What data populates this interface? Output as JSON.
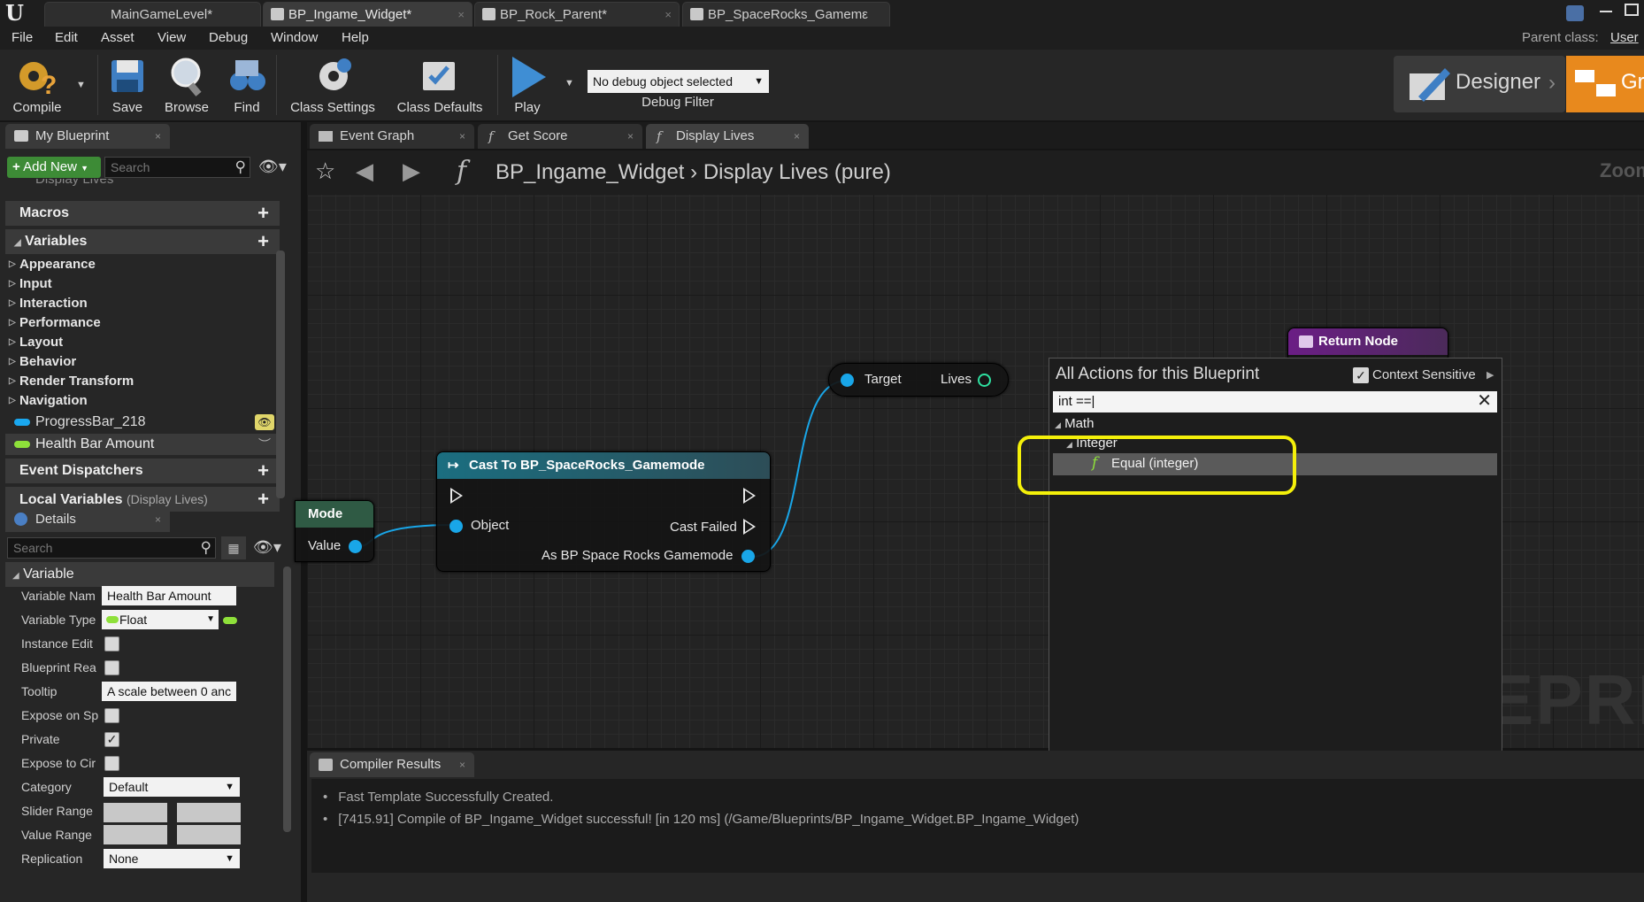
{
  "app": {
    "logo": "U",
    "tabs": [
      {
        "label": "MainGameLevel*"
      },
      {
        "label": "BP_Ingame_Widget*"
      },
      {
        "label": "BP_Rock_Parent*"
      },
      {
        "label": "BP_SpaceRocks_Gamemε"
      }
    ],
    "parent_class_label": "Parent class:",
    "parent_class_value": "User"
  },
  "menu": [
    "File",
    "Edit",
    "Asset",
    "View",
    "Debug",
    "Window",
    "Help"
  ],
  "toolbar": {
    "compile": "Compile",
    "save": "Save",
    "browse": "Browse",
    "find": "Find",
    "class_settings": "Class Settings",
    "class_defaults": "Class Defaults",
    "play": "Play",
    "debug_object": "No debug object selected",
    "debug_filter": "Debug Filter",
    "designer": "Designer",
    "graph": "Gr"
  },
  "my_blueprint": {
    "tab": "My Blueprint",
    "add_new": "Add New",
    "search_placeholder": "Search",
    "partial_item": "Display Lives",
    "macros": "Macros",
    "variables": "Variables",
    "categories": [
      "Appearance",
      "Input",
      "Interaction",
      "Performance",
      "Layout",
      "Behavior",
      "Render Transform",
      "Navigation"
    ],
    "vars": [
      {
        "name": "ProgressBar_218",
        "type_color": "#1aa8f0"
      },
      {
        "name": "Health Bar Amount",
        "type_color": "#8ee03a"
      }
    ],
    "event_dispatchers": "Event Dispatchers",
    "local_variables": "Local Variables",
    "local_variables_scope": "(Display Lives)"
  },
  "details": {
    "tab": "Details",
    "search_placeholder": "Search",
    "section": "Variable",
    "rows": {
      "variable_name_label": "Variable Nam",
      "variable_name_value": "Health Bar Amount",
      "variable_type_label": "Variable Type",
      "variable_type_value": "Float",
      "instance_edit_label": "Instance Edit",
      "blueprint_read_label": "Blueprint Rea",
      "tooltip_label": "Tooltip",
      "tooltip_value": "A scale between 0 anc",
      "expose_spawn_label": "Expose on Sp",
      "private_label": "Private",
      "private_checked": "✓",
      "expose_cine_label": "Expose to Cir",
      "category_label": "Category",
      "category_value": "Default",
      "slider_range_label": "Slider Range",
      "value_range_label": "Value Range",
      "replication_label": "Replication",
      "replication_value": "None"
    }
  },
  "graph_tabs": [
    {
      "label": "Event Graph"
    },
    {
      "label": "Get Score"
    },
    {
      "label": "Display Lives"
    }
  ],
  "breadcrumb": {
    "blueprint": "BP_Ingame_Widget",
    "function": "Display Lives (pure)",
    "zoom": "Zoom"
  },
  "nodes": {
    "get_game_mode": {
      "title": "Mode",
      "pin": "Value"
    },
    "cast": {
      "title": "Cast To BP_SpaceRocks_Gamemode",
      "object_pin": "Object",
      "cast_failed_pin": "Cast Failed",
      "as_pin": "As BP Space Rocks Gamemode"
    },
    "get_lives": {
      "target_pin": "Target",
      "lives_pin": "Lives"
    },
    "return_node": {
      "title": "Return Node"
    }
  },
  "action_menu": {
    "title": "All Actions for this Blueprint",
    "context_sensitive": "Context Sensitive",
    "search_value": "int ==",
    "category": "Math",
    "subcategory": "Integer",
    "result": "Equal (integer)"
  },
  "watermark": "EPRIN",
  "compiler_results": {
    "tab": "Compiler Results",
    "lines": [
      "Fast Template Successfully Created.",
      "[7415.91] Compile of BP_Ingame_Widget successful! [in 120 ms] (/Game/Blueprints/BP_Ingame_Widget.BP_Ingame_Widget)"
    ]
  },
  "colors": {
    "accent_orange": "#e8891d",
    "cast_header": "#1b6e80",
    "return_header": "#6b1e85",
    "highlight": "#f4f00a",
    "object_pin": "#19a6e8",
    "int_pin": "#2ee0a0"
  }
}
